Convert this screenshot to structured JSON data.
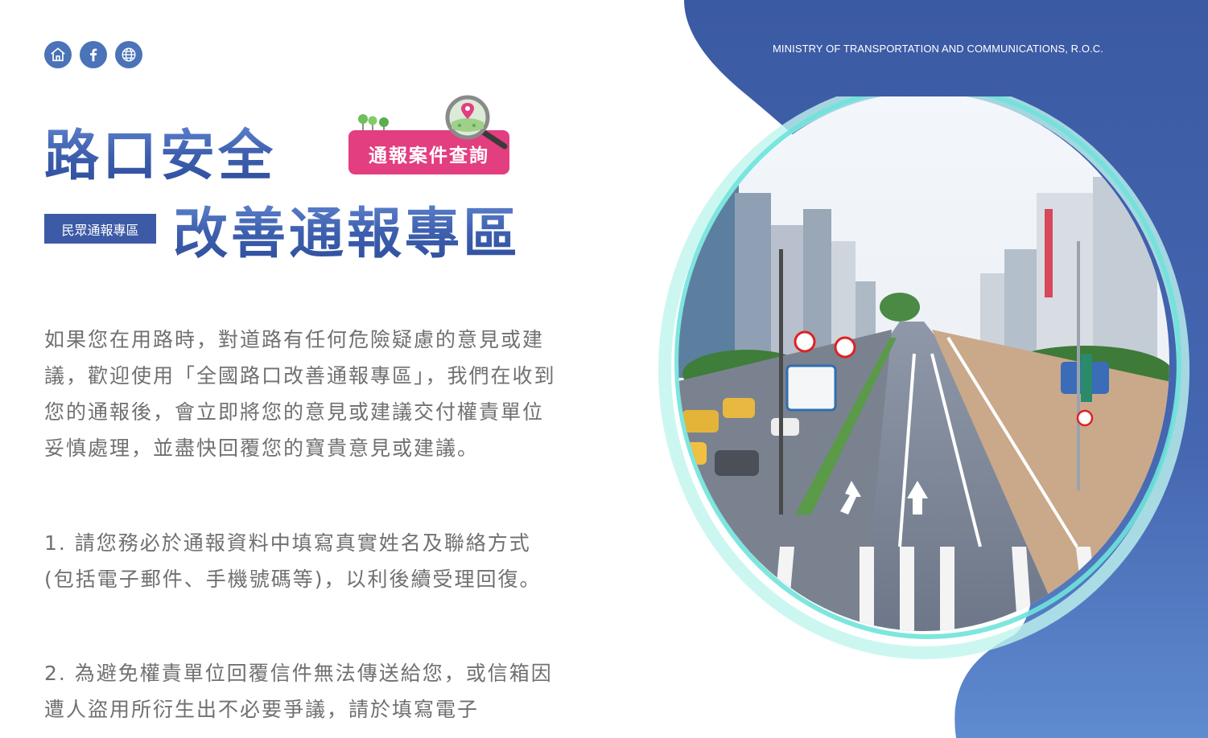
{
  "header": {
    "ministry": "MINISTRY OF TRANSPORTATION AND COMMUNICATIONS, R.O.C."
  },
  "nav_icons": [
    {
      "name": "home-icon"
    },
    {
      "name": "facebook-icon"
    },
    {
      "name": "globe-icon"
    }
  ],
  "title": {
    "line1": "路口安全",
    "line2": "改善通報專區",
    "badge": "民眾通報專區"
  },
  "query_button": {
    "label": "通報案件查詢"
  },
  "content": {
    "intro": "如果您在用路時，對道路有任何危險疑慮的意見或建議，歡迎使用「全國路口改善通報專區」，我們在收到您的通報後，會立即將您的意見或建議交付權責單位妥慎處理，並盡快回覆您的寶貴意見或建議。",
    "note1": "1. 請您務必於通報資料中填寫真實姓名及聯絡方式(包括電子郵件、手機號碼等)，以利後續受理回復。",
    "note2": "2. 為避免權責單位回覆信件無法傳送給您，或信箱因遭人盜用所衍生出不必要爭議，請於填寫電子"
  },
  "colors": {
    "primary_blue": "#4a73b8",
    "badge_blue": "#3d5aa6",
    "query_pink": "#e23e80",
    "text_gray": "#707070"
  }
}
